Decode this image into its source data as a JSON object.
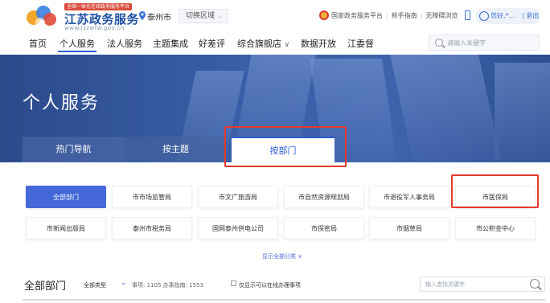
{
  "header": {
    "badge": "全国一体化在线政务服务平台",
    "brand_name": "江苏政务服务",
    "brand_url": "www.jszwfw.gov.cn",
    "city": "泰州市",
    "switch_region": "切换区域",
    "links": [
      "国家政务服务平台",
      "新手指南",
      "无障碍浏览"
    ],
    "user_greeting": "您好,*...",
    "logout": "退出"
  },
  "nav": {
    "items": [
      "首页",
      "个人服务",
      "法人服务",
      "主题集成",
      "好差评",
      "综合旗舰店",
      "数据开放",
      "江委督"
    ],
    "active_index": 1,
    "search_placeholder": "请输入关键字"
  },
  "banner": {
    "title": "个人服务",
    "tabs": [
      "热门导航",
      "按主题",
      "按部门"
    ],
    "active_tab": 2
  },
  "departments": {
    "row1": [
      "全部部门",
      "市市场监管局",
      "市文广旅游局",
      "市自然资源规划局",
      "市退役军人事务局",
      "市医保局"
    ],
    "row2": [
      "市新闻出版局",
      "泰州市税务局",
      "国网泰州供电公司",
      "市保密局",
      "市烟草局",
      "市公积金中心"
    ],
    "active": "全部部门",
    "show_all": "显示全部分类 ∨"
  },
  "bottom": {
    "title": "全部部门",
    "type_filter": "全部类型",
    "stats": "事项: 1105 办事指南: 1553",
    "online_only": "仅显示可以在线办理事项",
    "search_placeholder": "输入查找关键字"
  },
  "colors": {
    "primary": "#2b5cd6",
    "active_dept": "#4468d8",
    "highlight_box": "#e33a2c",
    "brand_text": "#1f4fa3"
  }
}
